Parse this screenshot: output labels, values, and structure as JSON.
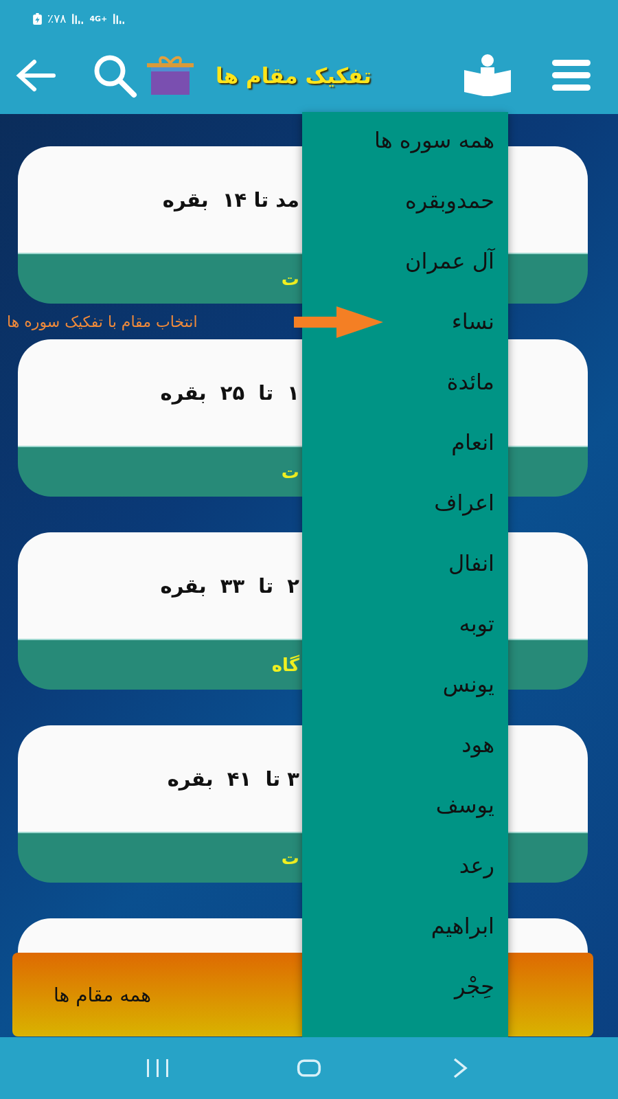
{
  "status_bar": {
    "battery": "٪۷۸",
    "network": "4G+"
  },
  "header": {
    "title": "تفکیک مقام ها"
  },
  "cards": [
    {
      "text": "مد تا ۱۴  بقره",
      "footer": "ت"
    },
    {
      "text": "۱  تا  ۲۵  بقره",
      "footer": "ت"
    },
    {
      "text": "۲  تا  ۳۳  بقره",
      "footer": "گاه"
    },
    {
      "text": "۳ تا  ۴۱  بقره",
      "footer": "ت"
    }
  ],
  "more_cards_below": true,
  "annotation": {
    "text": "انتخاب مقام با تفکیک سوره ها"
  },
  "menu": {
    "items": [
      {
        "label": "همه سوره ها"
      },
      {
        "label": "حمدوبقره"
      },
      {
        "label": "آل عمران"
      },
      {
        "label": "نساء"
      },
      {
        "label": "مائدة"
      },
      {
        "label": "انعام"
      },
      {
        "label": "اعراف"
      },
      {
        "label": "انفال"
      },
      {
        "label": "توبه"
      },
      {
        "label": "یونس"
      },
      {
        "label": "هود"
      },
      {
        "label": "یوسف"
      },
      {
        "label": "رعد"
      },
      {
        "label": "ابراهیم"
      },
      {
        "label": "حِجْر"
      }
    ]
  },
  "bottom_bar": {
    "label": "همه مقام ها"
  }
}
